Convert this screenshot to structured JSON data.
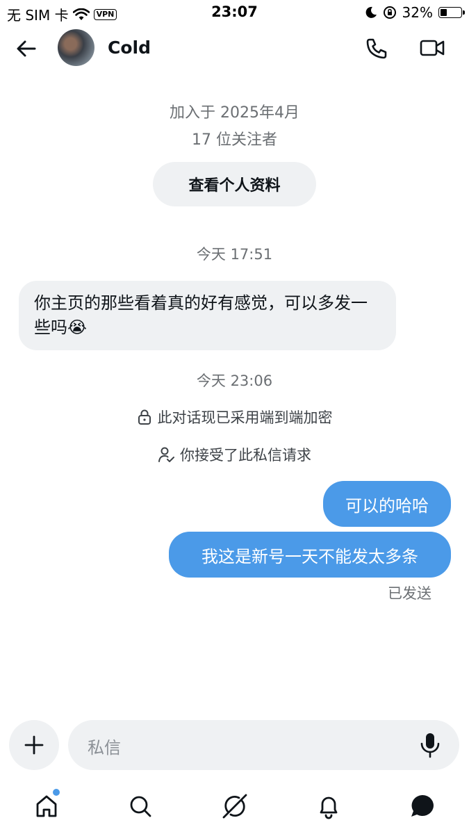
{
  "status_bar": {
    "carrier": "无 SIM 卡",
    "vpn": "VPN",
    "time": "23:07",
    "battery_percent": "32%",
    "battery_level": 0.32
  },
  "header": {
    "contact_name": "Cold",
    "icons": [
      "back-arrow-icon",
      "phone-icon",
      "video-camera-icon"
    ]
  },
  "profile_info": {
    "joined": "加入于 2025年4月",
    "followers": "17 位关注者",
    "view_profile_label": "查看个人资料"
  },
  "messages": {
    "time1": "今天 17:51",
    "incoming_text": "你主页的那些看着真的好有感觉，可以多发一些吗😭",
    "time2": "今天 23:06",
    "encryption_notice": "此对话现已采用端到端加密",
    "accepted_notice": "你接受了此私信请求",
    "outgoing_1": "可以的哈哈",
    "outgoing_2": "我这是新号一天不能发太多条",
    "sent_status": "已发送"
  },
  "composer": {
    "placeholder": "私信"
  },
  "colors": {
    "accent": "#4b9ae8",
    "bubble_in": "#eff1f3",
    "muted_text": "#6b6f73"
  },
  "tab_bar": [
    "home-icon",
    "search-icon",
    "grok-icon",
    "notifications-icon",
    "messages-icon"
  ]
}
